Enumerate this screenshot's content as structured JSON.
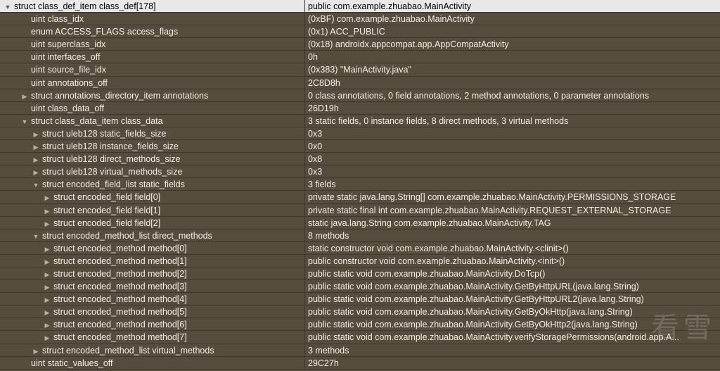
{
  "rows": [
    {
      "depth": 0,
      "exp": "open",
      "left": "struct class_def_item class_def[178]",
      "right": "public com.example.zhuabao.MainActivity"
    },
    {
      "depth": 1,
      "exp": "none",
      "left": "uint class_idx",
      "right": "(0xBF) com.example.zhuabao.MainActivity"
    },
    {
      "depth": 1,
      "exp": "none",
      "left": "enum ACCESS_FLAGS access_flags",
      "right": "(0x1) ACC_PUBLIC"
    },
    {
      "depth": 1,
      "exp": "none",
      "left": "uint superclass_idx",
      "right": "(0x18) androidx.appcompat.app.AppCompatActivity"
    },
    {
      "depth": 1,
      "exp": "none",
      "left": "uint interfaces_off",
      "right": "0h"
    },
    {
      "depth": 1,
      "exp": "none",
      "left": "uint source_file_idx",
      "right": "(0x383) \"MainActivity.java\""
    },
    {
      "depth": 1,
      "exp": "none",
      "left": "uint annotations_off",
      "right": "2C8D8h"
    },
    {
      "depth": 1,
      "exp": "closed",
      "left": "struct annotations_directory_item annotations",
      "right": "0 class annotations, 0 field annotations, 2 method annotations, 0 parameter annotations"
    },
    {
      "depth": 1,
      "exp": "none",
      "left": "uint class_data_off",
      "right": "26D19h"
    },
    {
      "depth": 1,
      "exp": "open",
      "left": "struct class_data_item class_data",
      "right": "3 static fields, 0 instance fields, 8 direct methods, 3 virtual methods"
    },
    {
      "depth": 2,
      "exp": "closed",
      "left": "struct uleb128 static_fields_size",
      "right": "0x3"
    },
    {
      "depth": 2,
      "exp": "closed",
      "left": "struct uleb128 instance_fields_size",
      "right": "0x0"
    },
    {
      "depth": 2,
      "exp": "closed",
      "left": "struct uleb128 direct_methods_size",
      "right": "0x8"
    },
    {
      "depth": 2,
      "exp": "closed",
      "left": "struct uleb128 virtual_methods_size",
      "right": "0x3"
    },
    {
      "depth": 2,
      "exp": "open",
      "left": "struct encoded_field_list static_fields",
      "right": "3 fields"
    },
    {
      "depth": 3,
      "exp": "closed",
      "left": "struct encoded_field field[0]",
      "right": "private static java.lang.String[] com.example.zhuabao.MainActivity.PERMISSIONS_STORAGE"
    },
    {
      "depth": 3,
      "exp": "closed",
      "left": "struct encoded_field field[1]",
      "right": "private static final int com.example.zhuabao.MainActivity.REQUEST_EXTERNAL_STORAGE"
    },
    {
      "depth": 3,
      "exp": "closed",
      "left": "struct encoded_field field[2]",
      "right": "static java.lang.String com.example.zhuabao.MainActivity.TAG"
    },
    {
      "depth": 2,
      "exp": "open",
      "left": "struct encoded_method_list direct_methods",
      "right": "8 methods"
    },
    {
      "depth": 3,
      "exp": "closed",
      "left": "struct encoded_method method[0]",
      "right": "static constructor void com.example.zhuabao.MainActivity.<clinit>()"
    },
    {
      "depth": 3,
      "exp": "closed",
      "left": "struct encoded_method method[1]",
      "right": "public constructor void com.example.zhuabao.MainActivity.<init>()"
    },
    {
      "depth": 3,
      "exp": "closed",
      "left": "struct encoded_method method[2]",
      "right": "public static void com.example.zhuabao.MainActivity.DoTcp()"
    },
    {
      "depth": 3,
      "exp": "closed",
      "left": "struct encoded_method method[3]",
      "right": "public static void com.example.zhuabao.MainActivity.GetByHttpURL(java.lang.String)"
    },
    {
      "depth": 3,
      "exp": "closed",
      "left": "struct encoded_method method[4]",
      "right": "public static void com.example.zhuabao.MainActivity.GetByHttpURL2(java.lang.String)"
    },
    {
      "depth": 3,
      "exp": "closed",
      "left": "struct encoded_method method[5]",
      "right": "public static void com.example.zhuabao.MainActivity.GetByOkHttp(java.lang.String)"
    },
    {
      "depth": 3,
      "exp": "closed",
      "left": "struct encoded_method method[6]",
      "right": "public static void com.example.zhuabao.MainActivity.GetByOkHttp2(java.lang.String)"
    },
    {
      "depth": 3,
      "exp": "closed",
      "left": "struct encoded_method method[7]",
      "right": "public static void com.example.zhuabao.MainActivity.verifyStoragePermissions(android.app.A..."
    },
    {
      "depth": 2,
      "exp": "closed",
      "left": "struct encoded_method_list virtual_methods",
      "right": "3 methods"
    },
    {
      "depth": 1,
      "exp": "none",
      "left": "uint static_values_off",
      "right": "29C27h"
    }
  ],
  "icons": {
    "expanded": "triangle-down-icon",
    "collapsed": "triangle-right-icon"
  }
}
